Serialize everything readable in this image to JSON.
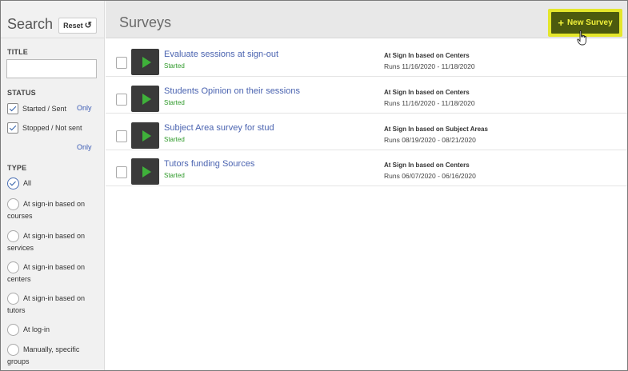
{
  "sidebar": {
    "title": "Search",
    "reset_label": "Reset",
    "title_section": "TITLE",
    "title_input_value": "",
    "status_section": "STATUS",
    "status_options": [
      {
        "label": "Started / Sent",
        "checked": true,
        "only": "Only"
      },
      {
        "label": "Stopped / Not sent",
        "checked": true,
        "only": "Only"
      }
    ],
    "type_section": "TYPE",
    "type_options": [
      {
        "line1": "All",
        "line2": "",
        "selected": true
      },
      {
        "line1": "At sign-in based on",
        "line2": "courses",
        "selected": false
      },
      {
        "line1": "At sign-in based on",
        "line2": "services",
        "selected": false
      },
      {
        "line1": "At sign-in based on",
        "line2": "centers",
        "selected": false
      },
      {
        "line1": "At sign-in based on",
        "line2": "tutors",
        "selected": false
      },
      {
        "line1": "At log-in",
        "line2": "",
        "selected": false
      },
      {
        "line1": "Manually, specific",
        "line2": "groups",
        "selected": false
      }
    ]
  },
  "main": {
    "title": "Surveys",
    "new_survey_label": "New Survey",
    "surveys": [
      {
        "name": "Evaluate sessions at sign-out",
        "status": "Started",
        "mode": "At Sign In based on Centers",
        "runs": "Runs 11/16/2020 - 11/18/2020"
      },
      {
        "name": "Students Opinion on their sessions",
        "status": "Started",
        "mode": "At Sign In based on Centers",
        "runs": "Runs 11/16/2020 - 11/18/2020"
      },
      {
        "name": "Subject Area survey for stud",
        "status": "Started",
        "mode": "At Sign In based on Subject Areas",
        "runs": "Runs 08/19/2020 - 08/21/2020"
      },
      {
        "name": "Tutors funding Sources",
        "status": "Started",
        "mode": "At Sign In based on Centers",
        "runs": "Runs 06/07/2020 - 06/16/2020"
      }
    ]
  },
  "colors": {
    "accent_highlight": "#e4e62b",
    "button_bg": "#4c5a0e",
    "link": "#4a63b0",
    "status_started": "#2f9a2a",
    "play_icon": "#3fb13a"
  },
  "icons": {
    "reset": "reset-icon",
    "play": "play-icon",
    "plus": "plus-icon",
    "cursor": "hand-cursor-icon"
  }
}
